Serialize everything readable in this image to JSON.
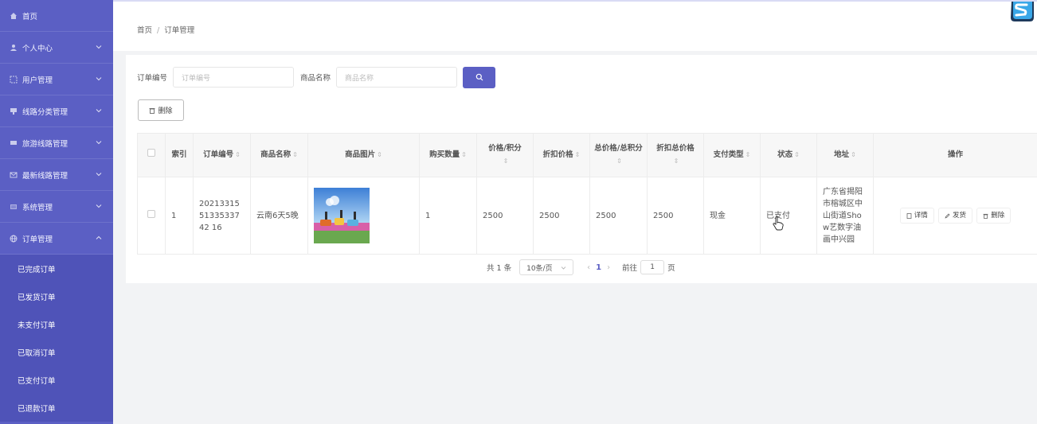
{
  "sidebar": {
    "items": [
      {
        "label": "首页",
        "icon": "home-icon"
      },
      {
        "label": "个人中心",
        "icon": "user-icon"
      },
      {
        "label": "用户管理",
        "icon": "users-icon"
      },
      {
        "label": "线路分类管理",
        "icon": "category-icon"
      },
      {
        "label": "旅游线路管理",
        "icon": "route-icon"
      },
      {
        "label": "最新线路管理",
        "icon": "mail-icon"
      },
      {
        "label": "系统管理",
        "icon": "settings-icon"
      },
      {
        "label": "订单管理",
        "icon": "globe-icon"
      }
    ],
    "order_submenu": [
      "已完成订单",
      "已发货订单",
      "未支付订单",
      "已取消订单",
      "已支付订单",
      "已退款订单"
    ]
  },
  "breadcrumb": {
    "home": "首页",
    "separator": "/",
    "current": "订单管理"
  },
  "search": {
    "order_no_label": "订单编号",
    "order_no_placeholder": "订单编号",
    "product_label": "商品名称",
    "product_placeholder": "商品名称"
  },
  "toolbar": {
    "delete_label": "删除"
  },
  "table": {
    "headers": {
      "index": "索引",
      "order_no": "订单编号",
      "product_name": "商品名称",
      "product_image": "商品图片",
      "quantity": "购买数量",
      "price": "价格/积分",
      "discount_price": "折扣价格",
      "total_price": "总价格/总积分",
      "discount_total": "折扣总价格",
      "pay_type": "支付类型",
      "status": "状态",
      "address": "地址",
      "actions": "操作"
    },
    "rows": [
      {
        "index": "1",
        "order_no": "202133155133533742 16",
        "product_name": "云南6天5晚",
        "quantity": "1",
        "price": "2500",
        "discount_price": "2500",
        "total_price": "2500",
        "discount_total": "2500",
        "pay_type": "现金",
        "status": "已支付",
        "address": "广东省揭阳市榕城区中山街道Show艺数字油画中兴园"
      }
    ],
    "actions": {
      "detail": "详情",
      "ship": "发货",
      "delete": "删除"
    }
  },
  "pagination": {
    "total_text": "共 1 条",
    "page_size": "10条/页",
    "current_page": "1",
    "goto_label": "前往",
    "goto_value": "1",
    "page_suffix": "页"
  },
  "colors": {
    "primary": "#5b5fc4",
    "sidebar": "#5b5fc4"
  }
}
